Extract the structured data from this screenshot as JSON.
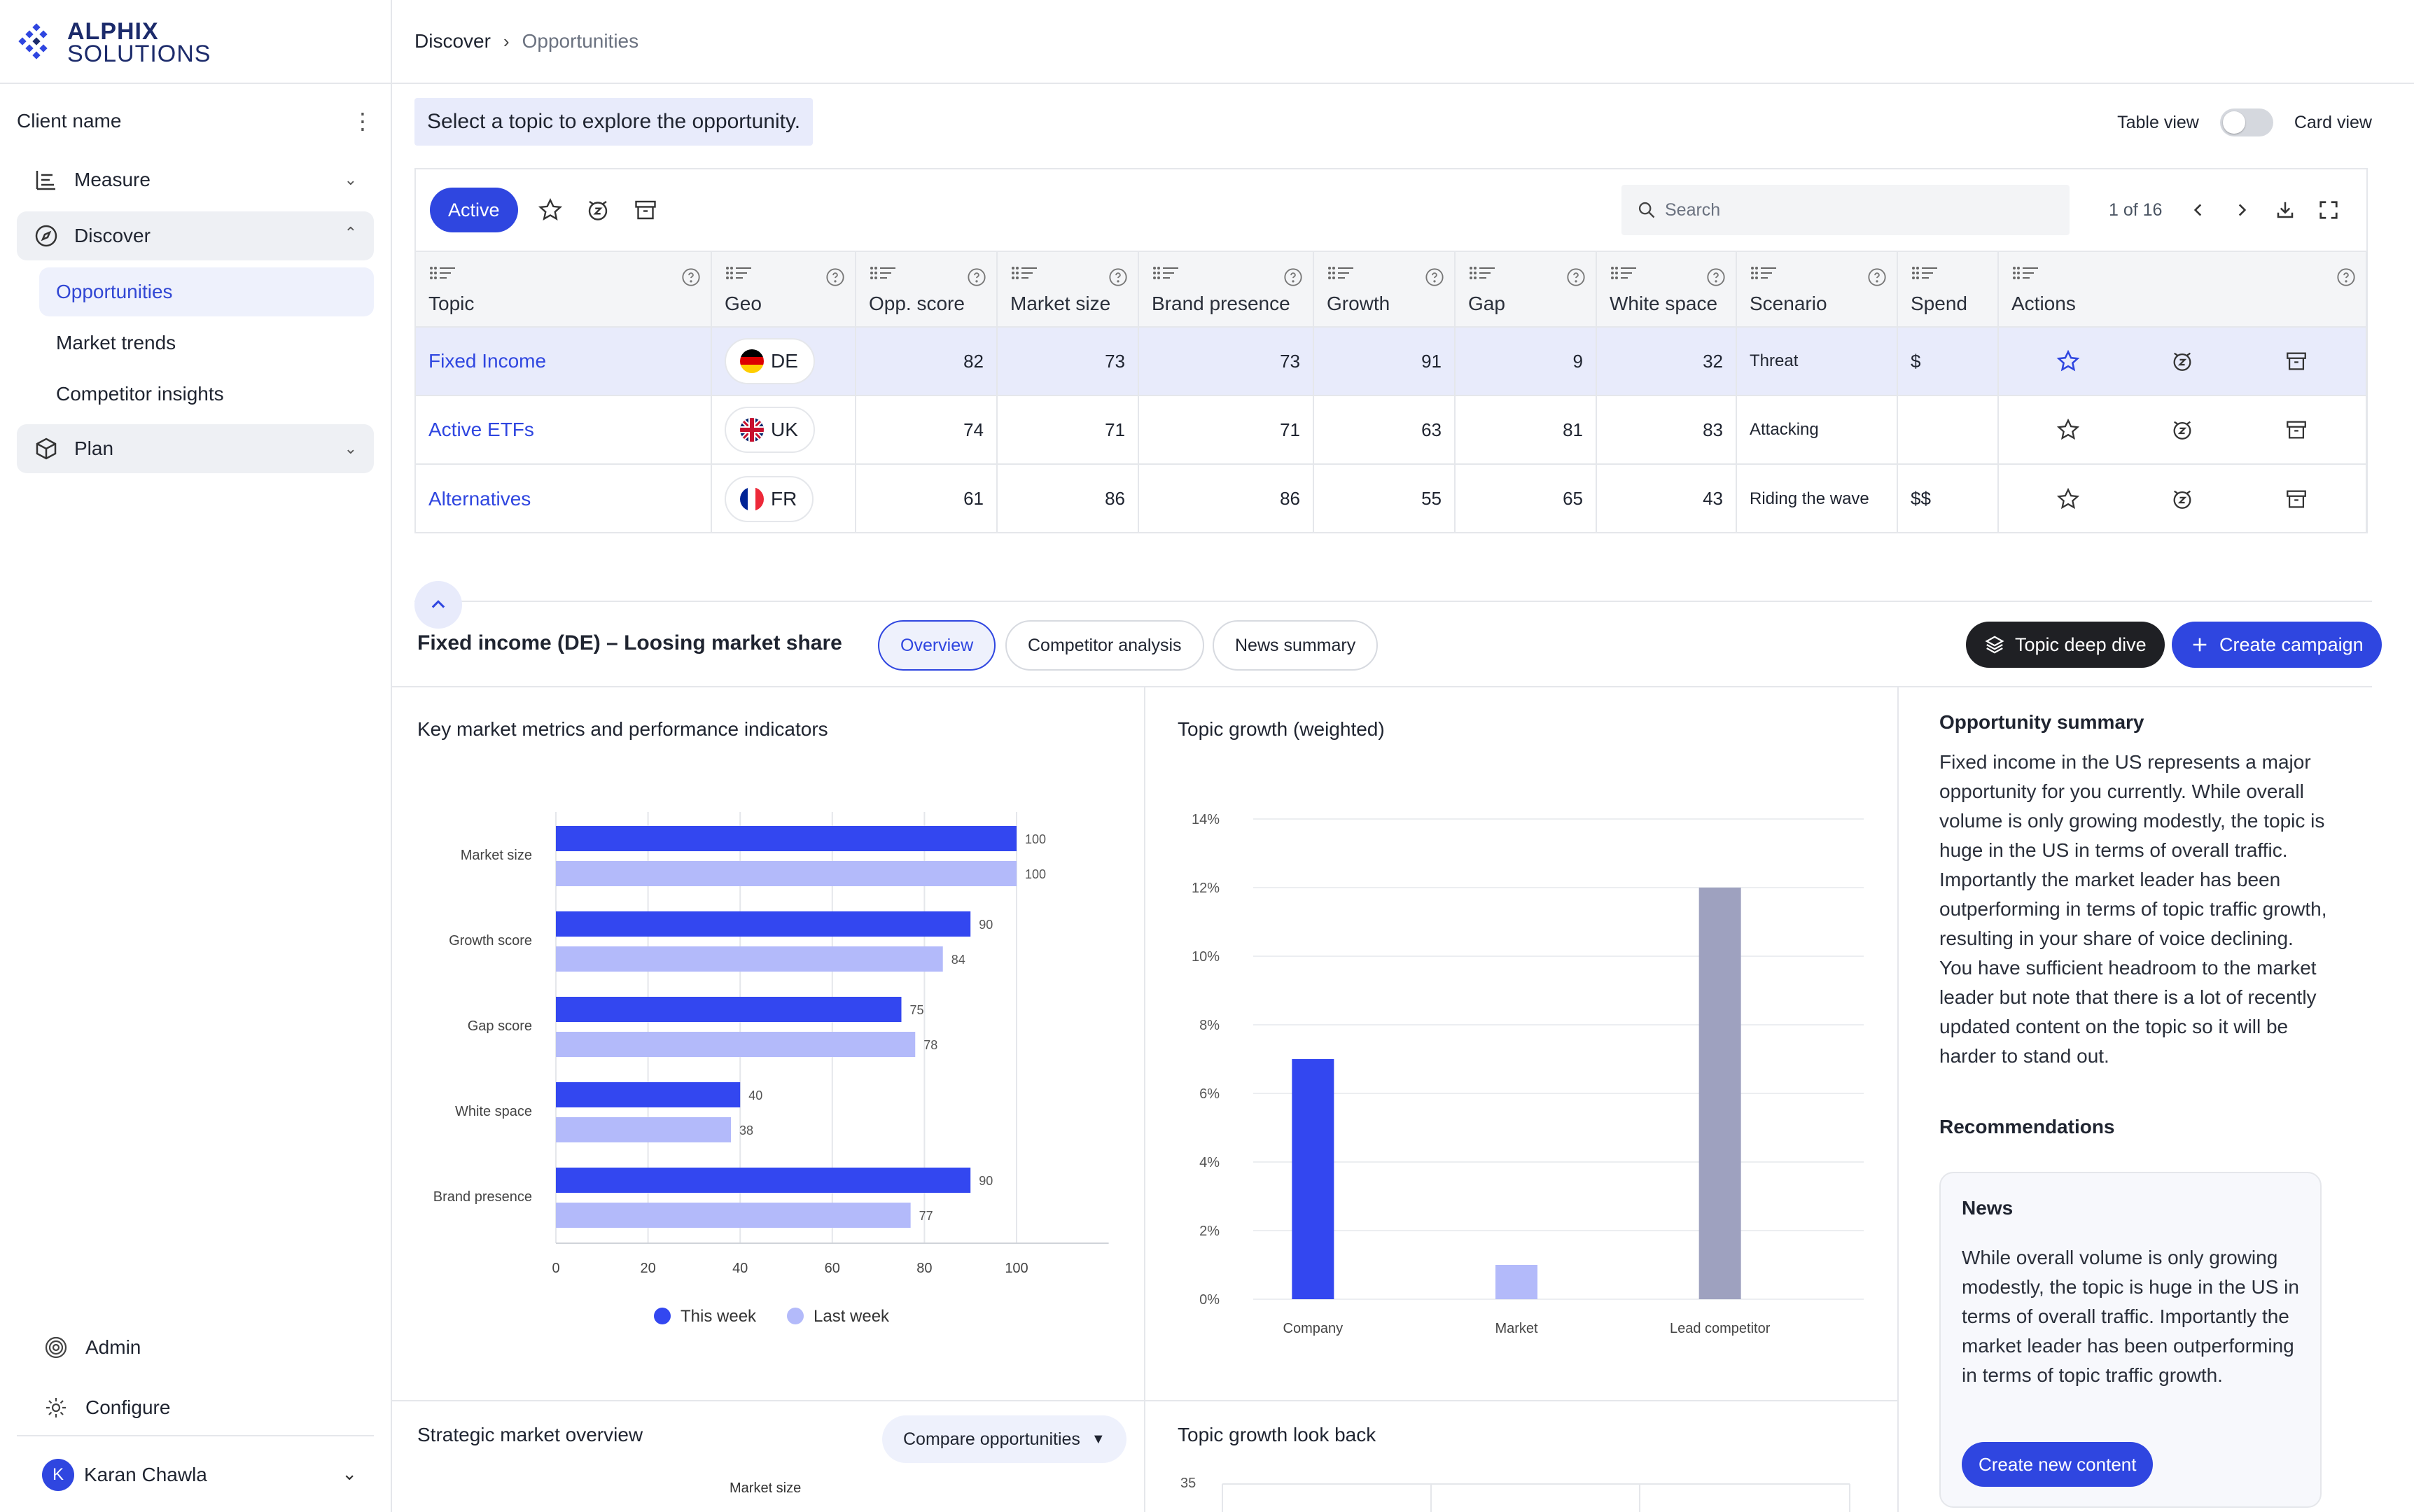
{
  "brand": {
    "line1": "ALPHIX",
    "line2": "SOLUTIONS",
    "color": "#1c2b6b"
  },
  "sidebar": {
    "client_name": "Client name",
    "nav": [
      {
        "label": "Measure",
        "icon": "bar-list-icon",
        "expanded": false
      },
      {
        "label": "Discover",
        "icon": "compass-icon",
        "expanded": true,
        "children": [
          "Opportunities",
          "Market trends",
          "Competitor insights"
        ]
      },
      {
        "label": "Plan",
        "icon": "cube-icon",
        "expanded": false
      }
    ],
    "bottom": [
      {
        "label": "Admin",
        "icon": "admin-icon"
      },
      {
        "label": "Configure",
        "icon": "gear-icon"
      }
    ],
    "user": {
      "initial": "K",
      "name": "Karan Chawla"
    }
  },
  "breadcrumb": {
    "parent": "Discover",
    "current": "Opportunities"
  },
  "prompt": "Select a topic to explore the opportunity.",
  "view_toggle": {
    "left": "Table view",
    "right": "Card view"
  },
  "toolbar": {
    "active_label": "Active",
    "search_placeholder": "Search",
    "pager": "1 of 16"
  },
  "table": {
    "columns": [
      "Topic",
      "Geo",
      "Opp. score",
      "Market size",
      "Brand presence",
      "Growth",
      "Gap",
      "White space",
      "Scenario",
      "Spend",
      "Actions"
    ],
    "rows": [
      {
        "topic": "Fixed Income",
        "geo": "DE",
        "opp": "82",
        "market": "73",
        "brand": "73",
        "growth": "91",
        "gap": "9",
        "white": "32",
        "scenario": "Threat",
        "spend": "$",
        "starred": true
      },
      {
        "topic": "Active ETFs",
        "geo": "UK",
        "opp": "74",
        "market": "71",
        "brand": "71",
        "growth": "63",
        "gap": "81",
        "white": "83",
        "scenario": "Attacking",
        "spend": "",
        "starred": false
      },
      {
        "topic": "Alternatives",
        "geo": "FR",
        "opp": "61",
        "market": "86",
        "brand": "86",
        "growth": "55",
        "gap": "65",
        "white": "43",
        "scenario": "Riding the wave",
        "spend": "$$",
        "starred": false
      }
    ]
  },
  "detail": {
    "title": "Fixed income (DE) – Loosing market share",
    "tabs": [
      "Overview",
      "Competitor analysis",
      "News summary"
    ],
    "btn_deep_dive": "Topic deep dive",
    "btn_campaign": "Create campaign"
  },
  "panels": {
    "metrics_title": "Key market metrics and performance indicators",
    "growth_title": "Topic growth (weighted)",
    "strategic_title": "Strategic market overview",
    "compare_label": "Compare opportunities",
    "lookback_title": "Topic growth look back",
    "strategic_axis_label": "Market size",
    "lookback_first_tick": "35"
  },
  "summary": {
    "title": "Opportunity summary",
    "text": "Fixed income in the US represents a major opportunity for you currently. While overall volume is only growing modestly, the topic is huge in the US in terms of overall traffic. Importantly the market leader has been outperforming in terms of topic traffic growth, resulting in your share of voice declining. You have sufficient headroom to the market leader but note that there is a lot of recently updated content on the topic so it will be harder to stand out.",
    "rec_title": "Recommendations",
    "card_title": "News",
    "card_text": "While overall volume is only growing modestly, the topic is huge in the US in terms of overall traffic. Importantly the market leader has been outperforming in terms of topic traffic growth.",
    "card_button": "Create new content"
  },
  "chart_data": [
    {
      "type": "bar",
      "orientation": "horizontal",
      "categories": [
        "Market size",
        "Growth score",
        "Gap score",
        "White space",
        "Brand presence"
      ],
      "series": [
        {
          "name": "This week",
          "values": [
            100,
            90,
            75,
            40,
            90
          ],
          "color": "#3347f0"
        },
        {
          "name": "Last week",
          "values": [
            100,
            84,
            78,
            38,
            77
          ],
          "color": "#b3bafa"
        }
      ],
      "xlim": [
        0,
        120
      ],
      "xticks": [
        0,
        20,
        40,
        60,
        80,
        100
      ],
      "legend": "bottom",
      "grid": true
    },
    {
      "type": "bar",
      "categories": [
        "Company",
        "Market",
        "Lead competitor"
      ],
      "values": [
        7,
        1,
        12
      ],
      "colors": [
        "#3347f0",
        "#b3bafa",
        "#9ea1bf"
      ],
      "ylim": [
        0,
        14
      ],
      "yticks": [
        "0%",
        "2%",
        "4%",
        "6%",
        "8%",
        "10%",
        "12%",
        "14%"
      ],
      "grid": true
    }
  ]
}
